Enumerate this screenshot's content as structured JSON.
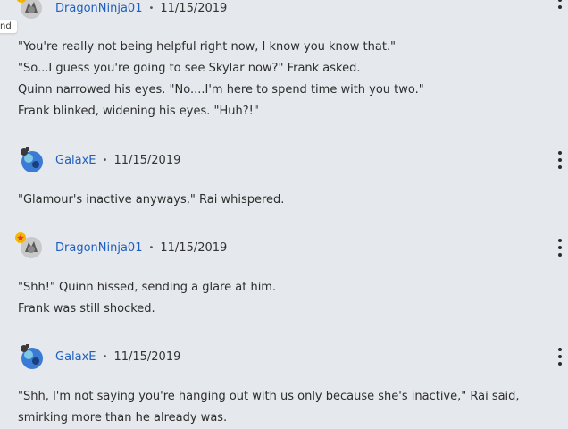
{
  "edge_label": "nd",
  "posts": [
    {
      "username": "DragonNinja01",
      "separator": "•",
      "date": "11/15/2019",
      "lines": [
        "\"You're really not being helpful right now, I know you know that.\"",
        "\"So...I guess you're going to see Skylar now?\" Frank asked.",
        "Quinn narrowed his eyes. \"No....I'm here to spend time with you two.\"",
        "Frank blinked, widening his eyes. \"Huh?!\""
      ]
    },
    {
      "username": "GalaxE",
      "separator": "•",
      "date": "11/15/2019",
      "lines": [
        "\"Glamour's inactive anyways,\" Rai whispered."
      ]
    },
    {
      "username": "DragonNinja01",
      "separator": "•",
      "date": "11/15/2019",
      "lines": [
        "\"Shh!\" Quinn hissed, sending a glare at him.",
        "Frank was still shocked."
      ]
    },
    {
      "username": "GalaxE",
      "separator": "•",
      "date": "11/15/2019",
      "lines": [
        "\"Shh, I'm not saying you're hanging out with us only because she's inactive,\" Rai said, smirking more than he already was."
      ]
    }
  ],
  "icons": {
    "dragon_avatar": "dragon-avatar-icon",
    "galaxe_avatar": "galaxy-avatar-icon",
    "more": "kebab-menu-icon",
    "badge": "star-badge-icon"
  },
  "colors": {
    "background": "#e5e8ec",
    "username_link": "#1f5fbf",
    "text": "#2d2d2d"
  }
}
